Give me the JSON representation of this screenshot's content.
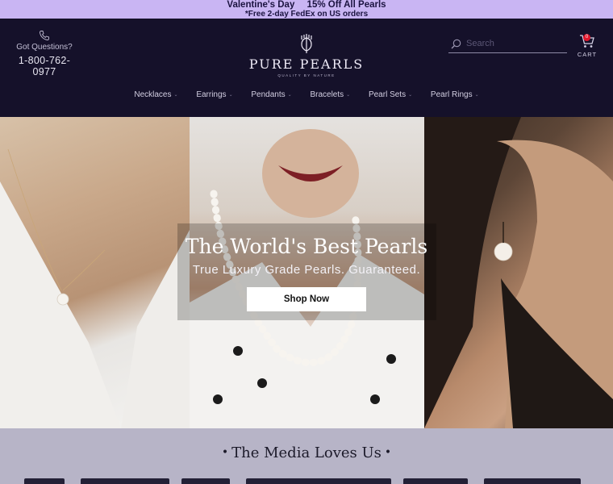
{
  "promo": {
    "headline_left": "Valentine's Day",
    "headline_right": "15% Off All Pearls",
    "shipping": "*Free 2-day FedEx on US orders"
  },
  "header": {
    "questions_label": "Got Questions?",
    "phone": "1-800-762-0977",
    "logo_text": "PURE PEARLS",
    "logo_tagline": "QUALITY BY NATURE",
    "search_placeholder": "Search",
    "cart_label": "CART",
    "cart_count": "0"
  },
  "nav": {
    "items": [
      {
        "label": "Necklaces"
      },
      {
        "label": "Earrings"
      },
      {
        "label": "Pendants"
      },
      {
        "label": "Bracelets"
      },
      {
        "label": "Pearl Sets"
      },
      {
        "label": "Pearl Rings"
      }
    ]
  },
  "hero": {
    "title": "The World's Best Pearls",
    "subtitle": "True Luxury Grade Pearls. Guaranteed.",
    "button": "Shop Now"
  },
  "media": {
    "title": "The Media Loves Us"
  },
  "colors": {
    "promo_bg": "#c9b5f3",
    "header_bg": "#15112a",
    "media_bg": "#b7b4c7",
    "cart_badge": "#e0162b"
  }
}
